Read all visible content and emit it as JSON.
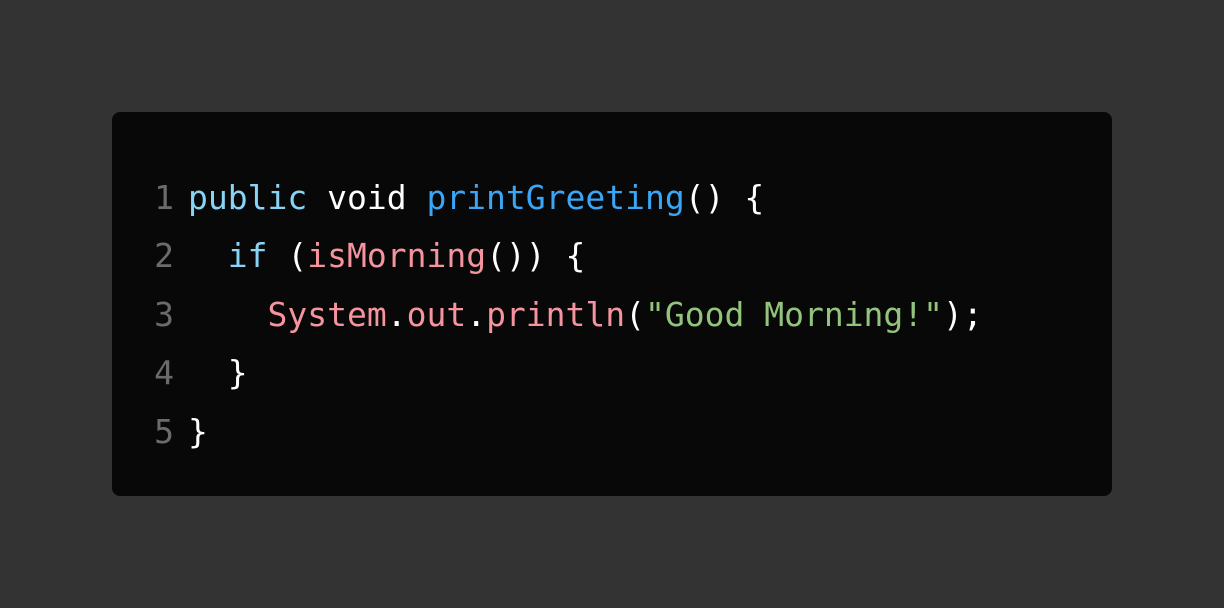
{
  "colors": {
    "background": "#333333",
    "panel": "#080808",
    "line_number": "#6b6b6b",
    "keyword": "#89d4f5",
    "function": "#3aa6f5",
    "identifier": "#f5939e",
    "string": "#93c47d",
    "plain": "#ffffff"
  },
  "code": {
    "lines": [
      {
        "number": "1",
        "tokens": [
          {
            "text": "public",
            "kind": "keyword"
          },
          {
            "text": " void ",
            "kind": "plain"
          },
          {
            "text": "printGreeting",
            "kind": "function"
          },
          {
            "text": "() {",
            "kind": "plain"
          }
        ]
      },
      {
        "number": "2",
        "tokens": [
          {
            "text": "  ",
            "kind": "plain"
          },
          {
            "text": "if",
            "kind": "keyword"
          },
          {
            "text": " (",
            "kind": "plain"
          },
          {
            "text": "isMorning",
            "kind": "identifier"
          },
          {
            "text": "()) {",
            "kind": "plain"
          }
        ]
      },
      {
        "number": "3",
        "tokens": [
          {
            "text": "    ",
            "kind": "plain"
          },
          {
            "text": "System",
            "kind": "identifier"
          },
          {
            "text": ".",
            "kind": "plain"
          },
          {
            "text": "out",
            "kind": "identifier"
          },
          {
            "text": ".",
            "kind": "plain"
          },
          {
            "text": "println",
            "kind": "identifier"
          },
          {
            "text": "(",
            "kind": "plain"
          },
          {
            "text": "\"Good Morning!\"",
            "kind": "string"
          },
          {
            "text": ");",
            "kind": "plain"
          }
        ]
      },
      {
        "number": "4",
        "tokens": [
          {
            "text": "  }",
            "kind": "plain"
          }
        ]
      },
      {
        "number": "5",
        "tokens": [
          {
            "text": "}",
            "kind": "plain"
          }
        ]
      }
    ]
  }
}
